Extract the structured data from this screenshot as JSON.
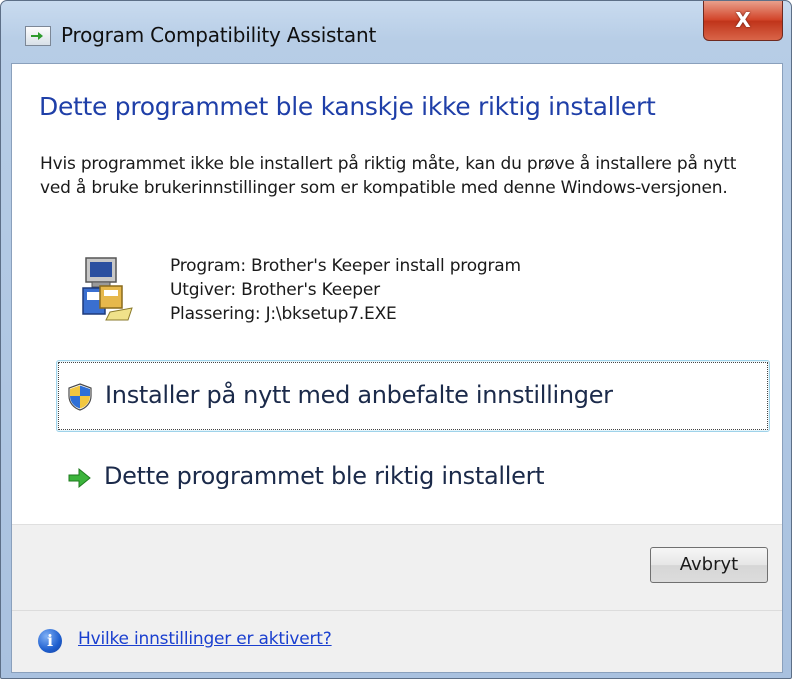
{
  "window": {
    "title": "Program Compatibility Assistant",
    "close_glyph": "X"
  },
  "dialog": {
    "heading": "Dette programmet ble kanskje ikke riktig installert",
    "body": "Hvis programmet ikke ble installert på riktig måte, kan du prøve å installere på nytt ved å bruke brukerinnstillinger som er kompatible med denne Windows-versjonen.",
    "program_info": {
      "program": "Program: Brother's Keeper install program",
      "publisher": "Utgiver: Brother's Keeper",
      "location": "Plassering: J:\\bksetup7.EXE"
    },
    "commands": {
      "reinstall_label": "Installer på nytt med anbefalte innstillinger",
      "reinstall_icon": "uac-shield-icon",
      "installed_ok_label": "Dette programmet ble riktig installert",
      "installed_ok_icon": "green-arrow-icon"
    },
    "cancel_label": "Avbryt",
    "info_link": "Hvilke innstillinger er aktivert?",
    "info_icon_glyph": "i"
  },
  "colors": {
    "heading": "#1f3fa8",
    "link": "#1a3fcf",
    "close_button": "#c7432a",
    "command_border": "#9fd3ea"
  }
}
